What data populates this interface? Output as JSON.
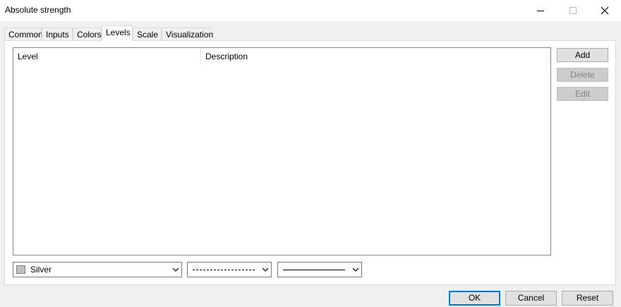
{
  "window": {
    "title": "Absolute strength"
  },
  "tabs": [
    {
      "label": "Common"
    },
    {
      "label": "Inputs"
    },
    {
      "label": "Colors"
    },
    {
      "label": "Levels",
      "active": true
    },
    {
      "label": "Scale"
    },
    {
      "label": "Visualization"
    }
  ],
  "levels_table": {
    "columns": [
      "Level",
      "Description"
    ],
    "rows": []
  },
  "side_buttons": {
    "add": "Add",
    "delete": "Delete",
    "edit": "Edit"
  },
  "line_settings": {
    "color_name": "Silver",
    "color_hex": "#c0c0c0",
    "style": "dashed",
    "width": "solid"
  },
  "footer": {
    "ok": "OK",
    "cancel": "Cancel",
    "reset": "Reset"
  },
  "icons": {
    "minimize": "minimize-icon",
    "maximize": "maximize-icon",
    "close": "close-icon",
    "dropdown": "chevron-down-icon"
  }
}
